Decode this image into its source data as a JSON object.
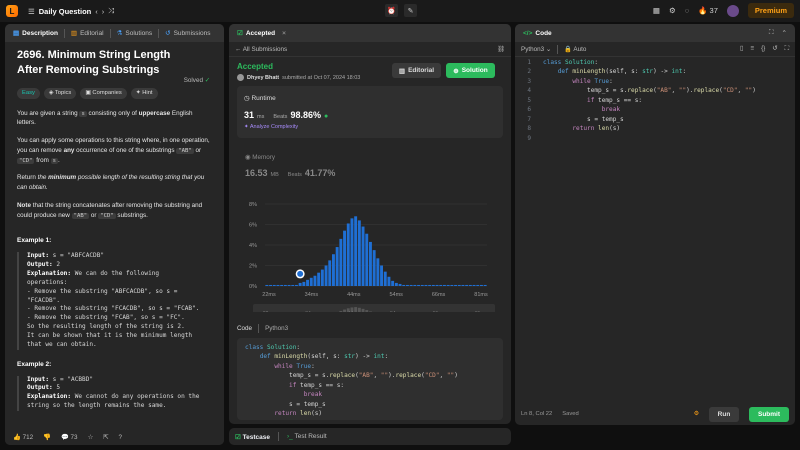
{
  "topbar": {
    "title": "Daily Question",
    "streak": "37",
    "premium": "Premium"
  },
  "left": {
    "tabs": [
      "Description",
      "Editorial",
      "Solutions",
      "Submissions"
    ],
    "title": "2696. Minimum String Length After Removing Substrings",
    "solved": "Solved",
    "chips": [
      "Easy",
      "Topics",
      "Companies",
      "Hint"
    ],
    "p1a": "You are given a string ",
    "p1code": "s",
    "p1b": " consisting only of ",
    "p1bold": "uppercase",
    "p1c": " English letters.",
    "p2a": "You can apply some operations to this string where, in one operation, you can remove ",
    "p2bold": "any",
    "p2b": " occurrence of one of the substrings ",
    "p2c1": "\"AB\"",
    "p2or": " or ",
    "p2c2": "\"CD\"",
    "p2from": " from ",
    "p2s": "s",
    "p2end": ".",
    "p3a": "Return ",
    "p3b": "the ",
    "p3bold": "minimum",
    "p3c": " possible length of the resulting string that you can obtain.",
    "p4bold": "Note",
    "p4a": " that the string concatenates after removing the substring and could produce new ",
    "p4c1": "\"AB\"",
    "p4or": " or ",
    "p4c2": "\"CD\"",
    "p4end": " substrings.",
    "ex1_title": "Example 1:",
    "ex1": [
      {
        "b": "Input:",
        "t": " s = \"ABFCACDB\""
      },
      {
        "b": "Output:",
        "t": " 2"
      },
      {
        "b": "Explanation:",
        "t": " We can do the following"
      },
      {
        "b": "",
        "t": "operations:"
      },
      {
        "b": "",
        "t": "- Remove the substring \"ABFCACDB\", so s ="
      },
      {
        "b": "",
        "t": "\"FCACDB\"."
      },
      {
        "b": "",
        "t": "- Remove the substring \"FCACDB\", so s = \"FCAB\"."
      },
      {
        "b": "",
        "t": "- Remove the substring \"FCAB\", so s = \"FC\"."
      },
      {
        "b": "",
        "t": "So the resulting length of the string is 2."
      },
      {
        "b": "",
        "t": "It can be shown that it is the minimum length"
      },
      {
        "b": "",
        "t": "that we can obtain."
      }
    ],
    "ex2_title": "Example 2:",
    "ex2": [
      {
        "b": "Input:",
        "t": " s = \"ACBBD\""
      },
      {
        "b": "Output:",
        "t": " 5"
      },
      {
        "b": "Explanation:",
        "t": " We cannot do any operations on the"
      },
      {
        "b": "",
        "t": "string so the length remains the same."
      }
    ],
    "likes": "712",
    "comments": "73"
  },
  "mid": {
    "tab": "Accepted",
    "all": "All Submissions",
    "status": "Accepted",
    "user": "Dhyey Bhatt",
    "submitted": "submitted at Oct 07, 2024 18:03",
    "editorial": "Editorial",
    "solution": "Solution",
    "runtime_label": "Runtime",
    "runtime_val": "31",
    "runtime_unit": "ms",
    "beats": "Beats",
    "runtime_pct": "98.86%",
    "analyze": "Analyze Complexity",
    "memory_label": "Memory",
    "memory_val": "16.53",
    "memory_unit": "MB",
    "memory_pct": "41.77%",
    "y_ticks": [
      "8%",
      "6%",
      "4%",
      "2%",
      "0%"
    ],
    "x_ticks": [
      "22ms",
      "34ms",
      "44ms",
      "54ms",
      "66ms",
      "81ms"
    ],
    "bottom_ticks": [
      "22ms",
      "34ms",
      "44ms",
      "54ms",
      "66ms",
      "81ms"
    ],
    "code_label": "Code",
    "lang": "Python3",
    "bottom_tabs": [
      "Testcase",
      "Test Result"
    ]
  },
  "chart_data": {
    "type": "bar",
    "title": "",
    "xlabel": "",
    "ylabel": "",
    "ylim": [
      0,
      8
    ],
    "x_ticks": [
      "22ms",
      "34ms",
      "44ms",
      "54ms",
      "66ms",
      "81ms"
    ],
    "values": [
      0.1,
      0.1,
      0.1,
      0.1,
      0.1,
      0.1,
      0.1,
      0.1,
      0.1,
      0.3,
      0.4,
      0.6,
      0.8,
      1.0,
      1.3,
      1.6,
      2.0,
      2.5,
      3.1,
      3.8,
      4.6,
      5.4,
      6.1,
      6.6,
      6.8,
      6.4,
      5.8,
      5.1,
      4.3,
      3.5,
      2.7,
      2.0,
      1.4,
      0.9,
      0.5,
      0.3,
      0.2,
      0.1,
      0.1,
      0.1,
      0.1,
      0.1,
      0.1,
      0.1,
      0.1,
      0.1,
      0.1,
      0.1,
      0.1,
      0.1,
      0.1,
      0.1,
      0.1,
      0.1,
      0.1,
      0.1,
      0.1,
      0.1,
      0.1,
      0.1
    ],
    "highlight_index": 9
  },
  "right": {
    "title": "Code",
    "lang": "Python3",
    "auto": "Auto",
    "status": "Ln 8, Col 22",
    "saved": "Saved",
    "run": "Run",
    "submit": "Submit"
  }
}
